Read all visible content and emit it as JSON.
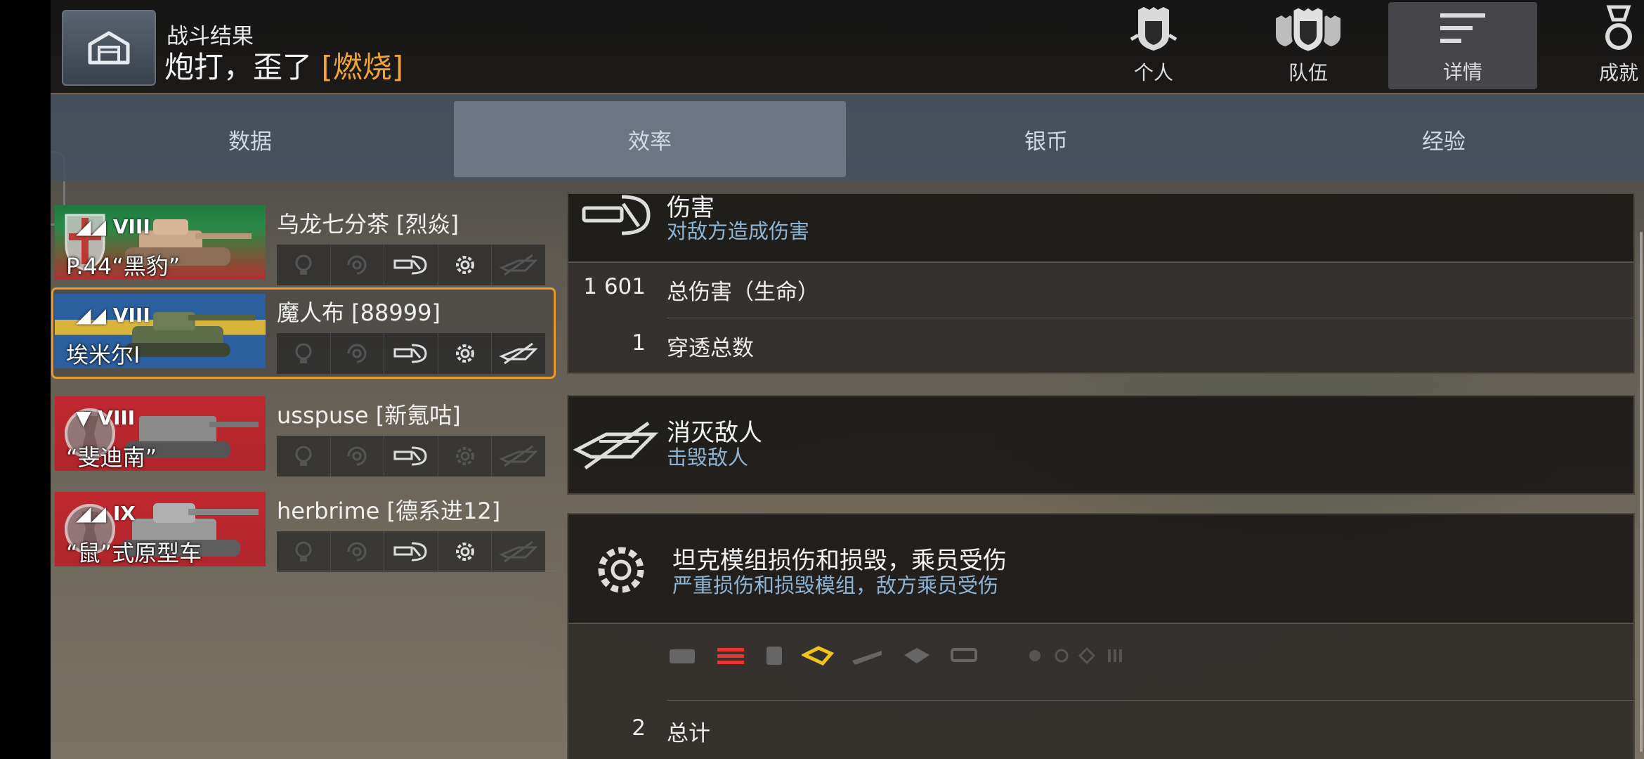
{
  "header": {
    "subtitle": "战斗结果",
    "title": "炮打，歪了",
    "title_tag": "[燃烧]",
    "nav": [
      {
        "label": "个人",
        "icon": "personal-icon"
      },
      {
        "label": "队伍",
        "icon": "team-icon"
      },
      {
        "label": "详情",
        "icon": "details-icon"
      },
      {
        "label": "成就",
        "icon": "achievement-icon"
      }
    ]
  },
  "tabs": [
    "数据",
    "效率",
    "银币",
    "经验"
  ],
  "active_tab": "效率",
  "players": [
    {
      "tier": "VIII",
      "tank": "P.44“黑豹”",
      "name": "乌龙七分茶 [烈焱]",
      "flag": "italy",
      "selected": false
    },
    {
      "tier": "VIII",
      "tank": "埃米尔I",
      "name": "魔人布 [88999]",
      "flag": "sweden",
      "selected": true
    },
    {
      "tier": "VIII",
      "tank": "“斐迪南”",
      "name": "usspuse [新氪咕]",
      "flag": "germany",
      "selected": false
    },
    {
      "tier": "IX",
      "tank": "“鼠”式原型车",
      "name": "herbrime [德系进12]",
      "flag": "germany",
      "selected": false
    }
  ],
  "damage": {
    "title": "伤害",
    "subtitle": "对敌方造成伤害",
    "rows": [
      {
        "value": "1 601",
        "label": "总伤害（生命）"
      },
      {
        "value": "1",
        "label": "穿透总数"
      }
    ]
  },
  "kills": {
    "title": "消灭敌人",
    "subtitle": "击毁敌人"
  },
  "modules": {
    "title": "坦克模组损伤和损毁，乘员受伤",
    "subtitle": "严重损伤和损毁模组，敌方乘员受伤",
    "total_value": "2",
    "total_label": "总计"
  }
}
